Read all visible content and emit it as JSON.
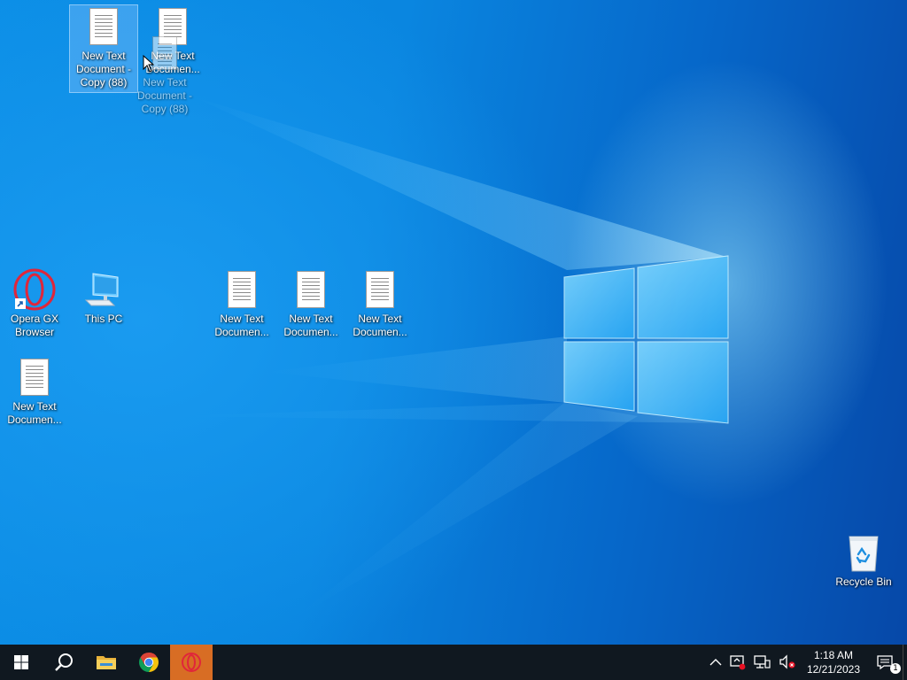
{
  "desktop": {
    "icons": [
      {
        "id": "doc-copy-88-selected",
        "label": "New Text Document - Copy (88)",
        "type": "text-document",
        "selected": true
      },
      {
        "id": "doc-top-2",
        "label": "New Text Documen...",
        "type": "text-document"
      },
      {
        "id": "doc-copy-88-dragging",
        "label": "New Text Document - Copy (88)",
        "type": "text-document",
        "dragging": true
      },
      {
        "id": "opera-gx",
        "label": "Opera GX Browser",
        "type": "shortcut",
        "icon": "opera-gx-icon"
      },
      {
        "id": "this-pc",
        "label": "This PC",
        "type": "system",
        "icon": "computer-icon"
      },
      {
        "id": "doc-mid-1",
        "label": "New Text Documen...",
        "type": "text-document"
      },
      {
        "id": "doc-mid-2",
        "label": "New Text Documen...",
        "type": "text-document"
      },
      {
        "id": "doc-mid-3",
        "label": "New Text Documen...",
        "type": "text-document"
      },
      {
        "id": "doc-left",
        "label": "New Text Documen...",
        "type": "text-document"
      },
      {
        "id": "recycle-bin",
        "label": "Recycle Bin",
        "type": "system",
        "icon": "recycle-bin-icon"
      }
    ]
  },
  "taskbar": {
    "buttons": [
      {
        "name": "start-button",
        "icon": "windows-logo-icon"
      },
      {
        "name": "search-button",
        "icon": "search-icon"
      },
      {
        "name": "file-explorer-button",
        "icon": "folder-icon"
      },
      {
        "name": "chrome-button",
        "icon": "chrome-icon"
      },
      {
        "name": "opera-gx-button",
        "icon": "opera-gx-icon",
        "active": true
      }
    ],
    "tray": {
      "time": "1:18 AM",
      "date": "12/21/2023",
      "notification_count": "1"
    }
  },
  "colors": {
    "taskbar_bg": "#101820",
    "active_app_bg": "#d86d24",
    "opera_red": "#e0263a",
    "chrome_red": "#db4437",
    "chrome_yellow": "#f4c20d",
    "chrome_green": "#0f9d58",
    "chrome_blue": "#4285f4"
  }
}
